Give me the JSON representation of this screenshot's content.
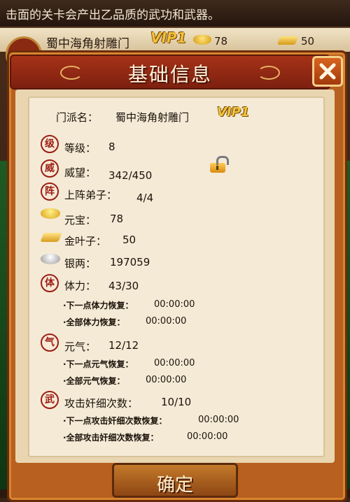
{
  "ticker": {
    "text": "击面的关卡会产出乙品质的武功和武器。"
  },
  "topbar": {
    "name": "蜀中海角射雕门",
    "vip": "VIP1",
    "ingot": "78",
    "gold_leaf": "50"
  },
  "dialog": {
    "title": "基础信息",
    "confirm_label": "确定",
    "sect_label": "门派名：",
    "sect_value": "蜀中海角射雕门",
    "vip": "VIP1",
    "rows": [
      {
        "badge": "级",
        "label": "等级：",
        "value": "8"
      },
      {
        "badge": "威",
        "label": "威望：",
        "value": "342/450"
      },
      {
        "badge": "阵",
        "label": "上阵弟子：",
        "value": "4/4"
      },
      {
        "label": "元宝：",
        "value": "78"
      },
      {
        "label": "金叶子：",
        "value": "50"
      },
      {
        "label": "银两：",
        "value": "197059"
      },
      {
        "badge": "体",
        "label": "体力：",
        "value": "43/30"
      },
      {
        "label": "·下一点体力恢复：",
        "value": "00:00:00"
      },
      {
        "label": "·全部体力恢复：",
        "value": "00:00:00"
      },
      {
        "badge": "气",
        "label": "元气：",
        "value": "12/12"
      },
      {
        "label": "·下一点元气恢复：",
        "value": "00:00:00"
      },
      {
        "label": "·全部元气恢复：",
        "value": "00:00:00"
      },
      {
        "badge": "武",
        "label": "攻击奸细次数：",
        "value": "10/10"
      },
      {
        "label": "·下一点攻击奸细次数恢复：",
        "value": "00:00:00"
      },
      {
        "label": "·全部攻击奸细次数恢复：",
        "value": "00:00:00"
      }
    ]
  }
}
